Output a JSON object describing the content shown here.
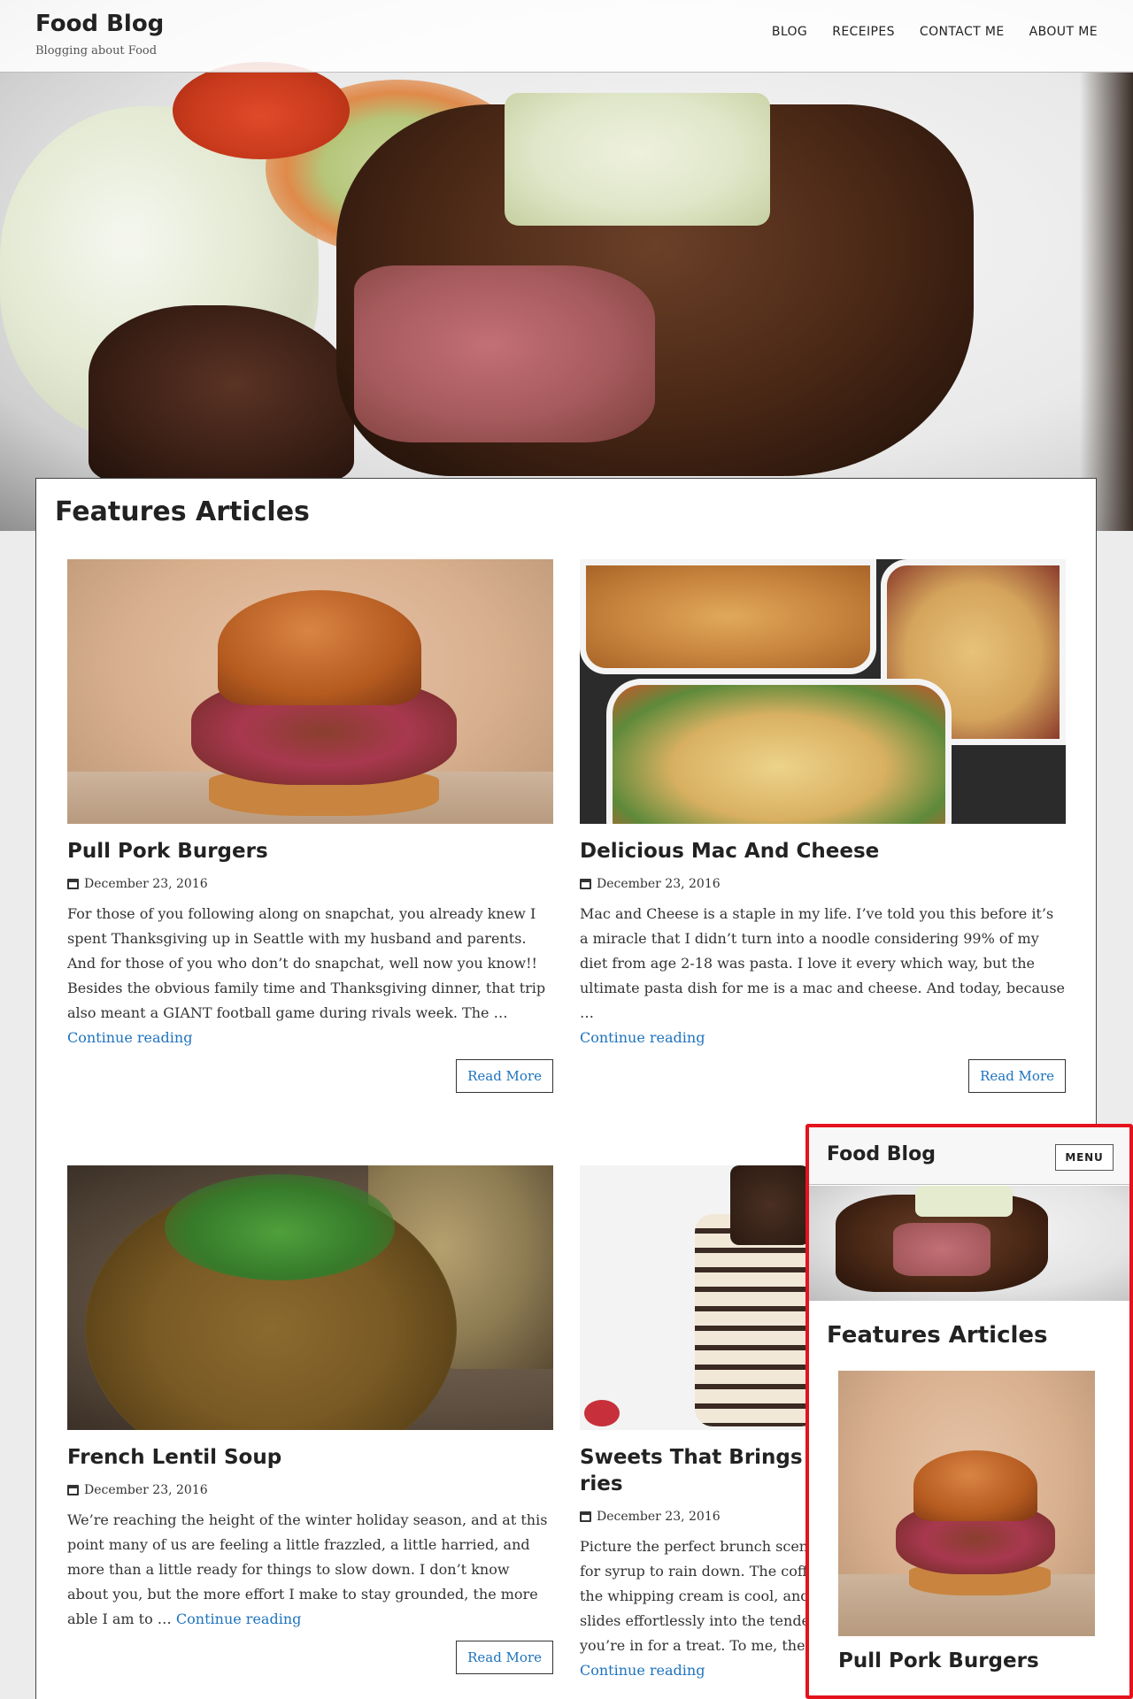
{
  "header": {
    "site_title": "Food Blog",
    "tagline": "Blogging about Food",
    "nav": [
      "BLOG",
      "RECEIPES",
      "CONTACT ME",
      "ABOUT ME"
    ]
  },
  "features": {
    "title": "Features Articles",
    "articles": [
      {
        "title": "Pull Pork Burgers",
        "date": "December 23, 2016",
        "excerpt": "For those of you following along on snapchat, you already knew I spent Thanksgiving up in Seattle with my husband and parents. And for those of you who don’t do snapchat, well now you know!! Besides the obvious family time and Thanksgiving dinner, that trip also meant a GIANT football game during rivals week. The …",
        "continue": "Continue reading",
        "read_more": "Read More",
        "image_icon": "burger-photo"
      },
      {
        "title": "Delicious Mac And Cheese",
        "date": "December 23, 2016",
        "excerpt": "Mac and Cheese is a staple in my life. I’ve told you this before it’s a miracle that I didn’t turn into a noodle considering 99% of my diet from age 2-18 was pasta. I love it every which way, but the ultimate pasta dish for me is a mac and cheese. And today, because …",
        "continue": "Continue reading",
        "read_more": "Read More",
        "image_icon": "mac-and-cheese-photo"
      },
      {
        "title": "French Lentil Soup",
        "date": "December 23, 2016",
        "excerpt": "We’re reaching the height of the winter holiday season, and at this point many of us are feeling a little frazzled, a little harried, and more than a little ready for things to slow down. I don’t know about you, but the more effort I make to stay grounded, the more able I am to …",
        "continue": "Continue reading",
        "read_more": "Read More",
        "image_icon": "lentil-soup-photo"
      },
      {
        "title": "Sweets That Brings B",
        "title_line2": "ries",
        "date": "December 23, 2016",
        "excerpt_lines": [
          "Picture the perfect brunch scene",
          "for syrup to rain down. The coff",
          "the whipping cream is cool, and",
          "slides effortlessly into the tende",
          "you’re in for a treat. To me, ther"
        ],
        "continue": "Continue reading",
        "image_icon": "pancake-stack-photo"
      }
    ]
  },
  "mobile_preview": {
    "site_title": "Food Blog",
    "menu_label": "MENU",
    "section_title": "Features Articles",
    "first_article_title": "Pull Pork Burgers",
    "border_color": "#e4121c"
  },
  "colors": {
    "link": "#1e73be",
    "text": "#222222",
    "page_background": "#ececec"
  },
  "icons": {
    "date": "calendar-icon"
  }
}
